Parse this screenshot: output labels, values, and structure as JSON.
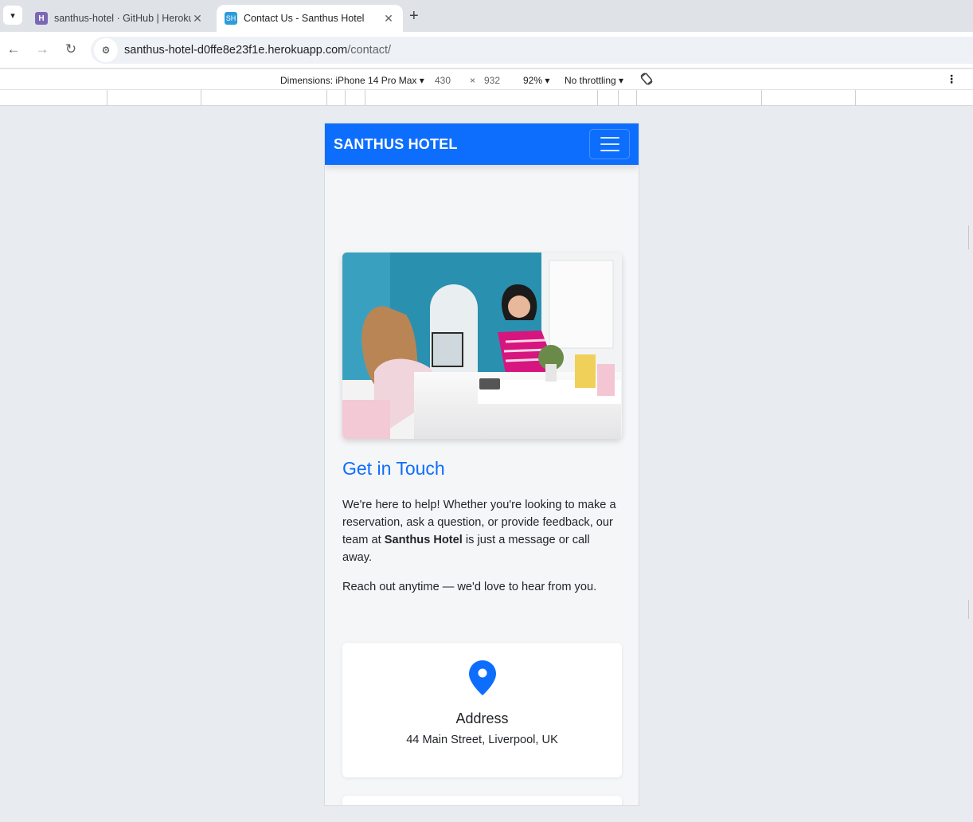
{
  "browser": {
    "tabs": [
      {
        "title": "santhus-hotel · GitHub | Heroku",
        "favicon": "heroku-icon",
        "active": false
      },
      {
        "title": "Contact Us - Santhus Hotel",
        "favicon": "SH",
        "active": true
      }
    ],
    "url_host": "santhus-hotel-d0ffe8e23f1e.herokuapp.com",
    "url_path": "/contact/"
  },
  "devtools": {
    "dimensions_label": "Dimensions: iPhone 14 Pro Max",
    "width": "430",
    "times": "×",
    "height": "932",
    "zoom": "92%",
    "throttling": "No throttling"
  },
  "site": {
    "brand": "SANTHUS HOTEL",
    "heading": "Get in Touch",
    "intro_before": "We're here to help! Whether you're looking to make a reservation, ask a question, or provide feedback, our team at ",
    "intro_bold": "Santhus Hotel",
    "intro_after": " is just a message or call away.",
    "reach": "Reach out anytime — we'd love to hear from you.",
    "address_card": {
      "title": "Address",
      "text": "44 Main Street, Liverpool, UK",
      "icon": "map-pin-icon"
    }
  },
  "colors": {
    "primary": "#0d6efd",
    "page_bg": "#f5f6f8"
  }
}
